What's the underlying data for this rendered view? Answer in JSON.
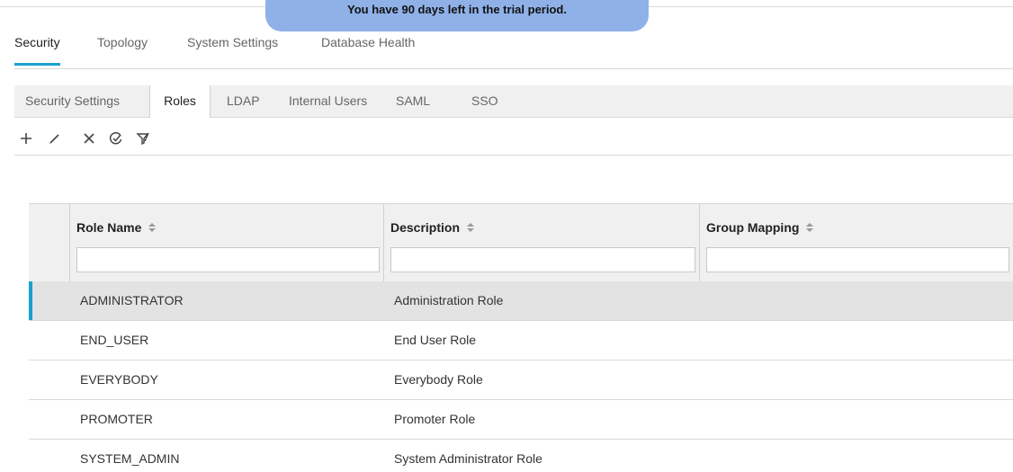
{
  "banner": {
    "text": "You have 90 days left in the trial period."
  },
  "main_tabs": [
    {
      "label": "Security",
      "active": true
    },
    {
      "label": "Topology",
      "active": false
    },
    {
      "label": "System Settings",
      "active": false
    },
    {
      "label": "Database Health",
      "active": false
    }
  ],
  "sub_tabs": [
    {
      "label": "Security Settings",
      "active": false
    },
    {
      "label": "Roles",
      "active": true
    },
    {
      "label": "LDAP",
      "active": false
    },
    {
      "label": "Internal Users",
      "active": false
    },
    {
      "label": "SAML",
      "active": false
    },
    {
      "label": "SSO",
      "active": false
    }
  ],
  "toolbar": {
    "icons": [
      "plus-icon",
      "pencil-icon",
      "close-icon",
      "check-circle-icon",
      "clear-filter-icon"
    ]
  },
  "grid": {
    "columns": [
      {
        "label": "Role Name",
        "filter_value": ""
      },
      {
        "label": "Description",
        "filter_value": ""
      },
      {
        "label": "Group Mapping",
        "filter_value": ""
      }
    ],
    "rows": [
      {
        "role": "ADMINISTRATOR",
        "description": "Administration Role",
        "group_mapping": "",
        "selected": true
      },
      {
        "role": "END_USER",
        "description": "End User Role",
        "group_mapping": "",
        "selected": false
      },
      {
        "role": "EVERYBODY",
        "description": "Everybody Role",
        "group_mapping": "",
        "selected": false
      },
      {
        "role": "PROMOTER",
        "description": "Promoter Role",
        "group_mapping": "",
        "selected": false
      },
      {
        "role": "SYSTEM_ADMIN",
        "description": "System Administrator Role",
        "group_mapping": "",
        "selected": false
      }
    ]
  },
  "colors": {
    "accent": "#1aa0cf",
    "banner": "#8fb1e8",
    "selected_row": "#e3e3e3",
    "tab_bar": "#f0f0f0"
  }
}
